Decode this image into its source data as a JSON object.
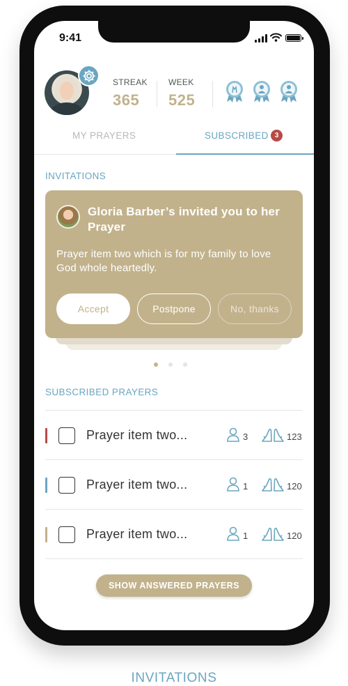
{
  "status_bar": {
    "time": "9:41"
  },
  "profile": {
    "streak_label": "STREAK",
    "streak_value": "365",
    "week_label": "WEEK",
    "week_value": "525",
    "badges": [
      "praying-hands-badge-icon",
      "person-badge-icon",
      "person-badge-icon"
    ]
  },
  "tabs": {
    "my_prayers": "MY PRAYERS",
    "subscribed": "SUBSCRIBED",
    "subscribed_count": "3",
    "active": "subscribed"
  },
  "invitations": {
    "title": "INVITATIONS",
    "card": {
      "title": "Gloria Barber’s invited you to her Prayer",
      "text": "Prayer item two which is for my family to love God whole heartedly.",
      "accept_label": "Accept",
      "postpone_label": "Postpone",
      "decline_label": "No, thanks"
    },
    "pagination": {
      "total": 3,
      "active": 1
    }
  },
  "subscribed": {
    "title": "SUBSCRIBED PRAYERS",
    "items": [
      {
        "title": "Prayer item two...",
        "people": "3",
        "prayers": "123",
        "color": "#b84a44"
      },
      {
        "title": "Prayer item two...",
        "people": "1",
        "prayers": "120",
        "color": "#6aa6c0"
      },
      {
        "title": "Prayer item two...",
        "people": "1",
        "prayers": "120",
        "color": "#c2b28c"
      }
    ]
  },
  "answered_button": "SHOW ANSWERED PRAYERS",
  "caption": "INVITATIONS",
  "colors": {
    "accent": "#6aa6c0",
    "gold": "#c2b28c",
    "alert": "#b84a44"
  }
}
